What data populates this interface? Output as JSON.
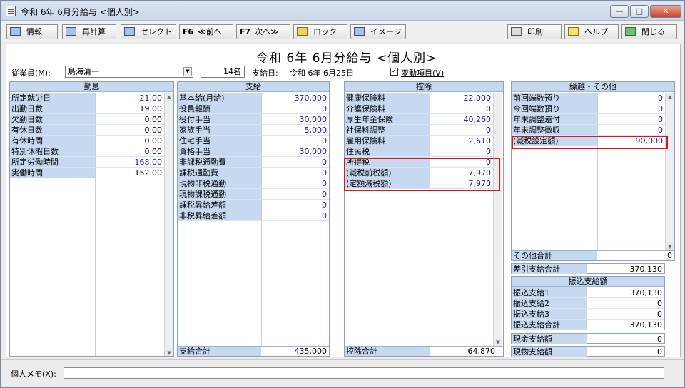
{
  "window": {
    "title": "令和 6年 6月分給与 <個人別>"
  },
  "toolbar": {
    "info": "情報",
    "recalc": "再計算",
    "select": "セレクト",
    "prev_key": "F6",
    "prev": "≪前へ",
    "next_key": "F7",
    "next": "次へ≫",
    "lock": "ロック",
    "image": "イメージ",
    "print": "印刷",
    "help": "ヘルプ",
    "close": "閉じる"
  },
  "header": {
    "page_title": "令和 6年 6月分給与 <個人別>",
    "employee_label": "従業員(M):",
    "employee_name": "鳥海清一",
    "employee_count": "14名",
    "payday_label": "支給日:",
    "payday": "令和 6年 6月25日",
    "variable_items": "変動項目(V)",
    "variable_checked": true
  },
  "attendance": {
    "title": "勤怠",
    "rows": [
      {
        "label": "所定就労日",
        "value": "21.00",
        "blue": true
      },
      {
        "label": "出勤日数",
        "value": "19.00",
        "blue": false
      },
      {
        "label": "欠勤日数",
        "value": "0.00",
        "blue": false
      },
      {
        "label": "有休日数",
        "value": "0.00",
        "blue": false
      },
      {
        "label": "有休時間",
        "value": "0.00",
        "blue": false
      },
      {
        "label": "特別休暇日数",
        "value": "0.00",
        "blue": false
      },
      {
        "label": "所定労働時間",
        "value": "168.00",
        "blue": true
      },
      {
        "label": "実働時間",
        "value": "152.00",
        "blue": false
      }
    ]
  },
  "payment": {
    "title": "支給",
    "rows": [
      {
        "label": "基本給(月給)",
        "value": "370,000"
      },
      {
        "label": "役員報酬",
        "value": "0"
      },
      {
        "label": "役付手当",
        "value": "30,000"
      },
      {
        "label": "家族手当",
        "value": "5,000"
      },
      {
        "label": "住宅手当",
        "value": "0"
      },
      {
        "label": "資格手当",
        "value": "30,000"
      },
      {
        "label": "非課税通勤費",
        "value": "0"
      },
      {
        "label": "課税通勤費",
        "value": "0"
      },
      {
        "label": "現物非税通勤",
        "value": "0"
      },
      {
        "label": "現物課税通勤",
        "value": "0"
      },
      {
        "label": "課税昇給差額",
        "value": "0"
      },
      {
        "label": "非税昇給差額",
        "value": "0"
      }
    ],
    "total_label": "支給合計",
    "total": "435,000"
  },
  "deduction": {
    "title": "控除",
    "rows": [
      {
        "label": "健康保険料",
        "value": "22,000"
      },
      {
        "label": "介護保険料",
        "value": "0"
      },
      {
        "label": "厚生年金保険",
        "value": "40,260"
      },
      {
        "label": "社保料調整",
        "value": "0"
      },
      {
        "label": "雇用保険料",
        "value": "2,610"
      },
      {
        "label": "住民税",
        "value": "0"
      },
      {
        "label": "所得税",
        "value": "0"
      },
      {
        "label": "(減税前税額)",
        "value": "7,970"
      },
      {
        "label": "(定額減税額)",
        "value": "7,970"
      }
    ],
    "total_label": "控除合計",
    "total": "64,870"
  },
  "carryover": {
    "title": "繰越・その他",
    "rows": [
      {
        "label": "前回端数預り",
        "value": "0"
      },
      {
        "label": "今回端数預り",
        "value": "0"
      },
      {
        "label": "年末調整還付",
        "value": "0"
      },
      {
        "label": "年末調整徴収",
        "value": "0"
      },
      {
        "label": "(減税設定額)",
        "value": "90,000"
      }
    ],
    "other_total_label": "その他合計",
    "other_total": "0",
    "net_label": "差引支給合計",
    "net": "370,130",
    "transfer_title": "振込支給額",
    "transfer_rows": [
      {
        "label": "振込支給1",
        "value": "370,130"
      },
      {
        "label": "振込支給2",
        "value": "0"
      },
      {
        "label": "振込支給3",
        "value": "0"
      },
      {
        "label": "振込支給合計",
        "value": "370,130"
      }
    ],
    "cash_label": "現金支給額",
    "cash": "0",
    "inkind_label": "現物支給額",
    "inkind": "0"
  },
  "memo": {
    "label": "個人メモ(X):",
    "value": ""
  },
  "colors": {
    "header_bg": "#c7d9f1",
    "value_blue": "#1c1ca0",
    "highlight": "#e1141a"
  }
}
